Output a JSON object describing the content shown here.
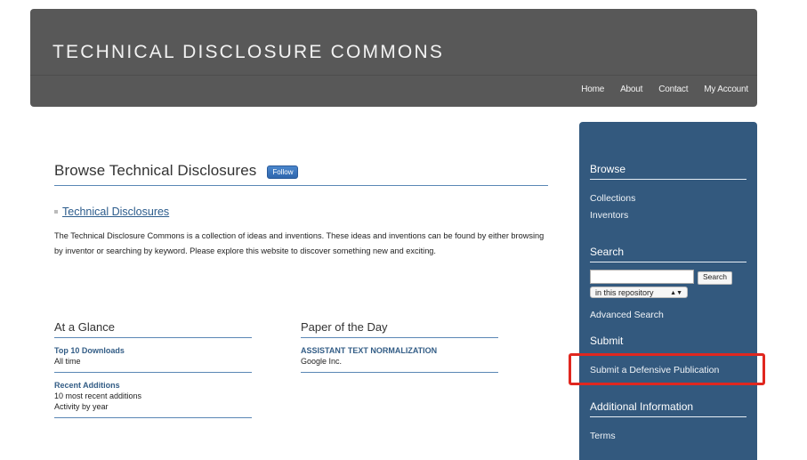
{
  "header": {
    "site_title": "TECHNICAL DISCLOSURE COMMONS",
    "nav": [
      "Home",
      "About",
      "Contact",
      "My Account"
    ]
  },
  "main": {
    "page_title": "Browse Technical Disclosures",
    "follow_label": "Follow",
    "collection_link": "Technical Disclosures",
    "intro": "The Technical Disclosure Commons is a collection of ideas and inventions. These ideas and inventions can be found by either browsing by inventor or searching by keyword. Please explore this website to discover something new and exciting."
  },
  "at_a_glance": {
    "heading": "At a Glance",
    "entries": [
      {
        "title": "Top 10 Downloads",
        "lines": [
          "All time"
        ]
      },
      {
        "title": "Recent Additions",
        "lines": [
          "10 most recent additions",
          "Activity by year"
        ]
      }
    ]
  },
  "paper_of_the_day": {
    "heading": "Paper of the Day",
    "title": "ASSISTANT TEXT NORMALIZATION",
    "author": "Google Inc."
  },
  "sidebar": {
    "browse_heading": "Browse",
    "browse_links": [
      "Collections",
      "Inventors"
    ],
    "search_heading": "Search",
    "search_value": "",
    "search_button": "Search",
    "scope_selected": "in this repository",
    "advanced_search": "Advanced Search",
    "submit_heading": "Submit",
    "submit_link": "Submit a Defensive Publication",
    "additional_heading": "Additional Information",
    "additional_links": [
      "Terms"
    ]
  },
  "annotation": {
    "highlight_color": "#e0271f",
    "highlight_target": "Submit a Defensive Publication"
  }
}
